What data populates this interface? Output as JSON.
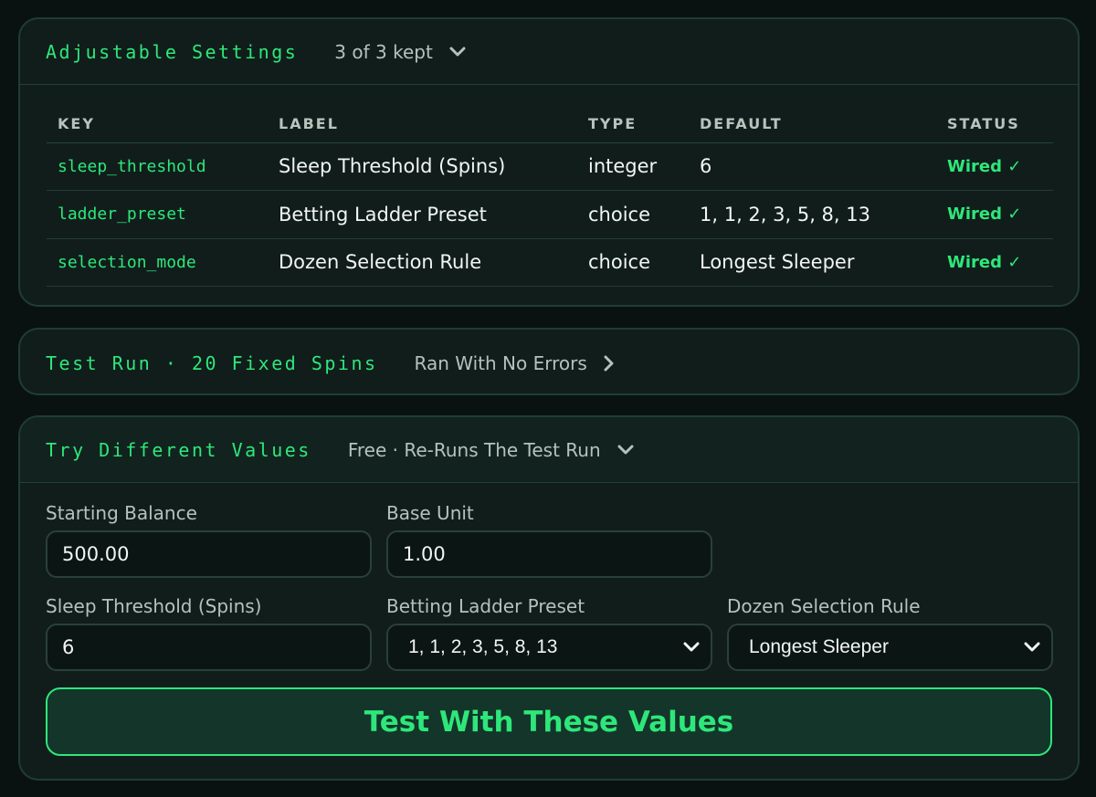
{
  "settings": {
    "title": "Adjustable Settings",
    "summary": "3 of 3 kept",
    "chevron": "chevron-down-icon",
    "columns": [
      "KEY",
      "LABEL",
      "TYPE",
      "DEFAULT",
      "STATUS"
    ],
    "rows": [
      {
        "key": "sleep_threshold",
        "label": "Sleep Threshold (Spins)",
        "type": "integer",
        "default": "6",
        "status": "Wired ✓"
      },
      {
        "key": "ladder_preset",
        "label": "Betting Ladder Preset",
        "type": "choice",
        "default": "1, 1, 2, 3, 5, 8, 13",
        "status": "Wired ✓"
      },
      {
        "key": "selection_mode",
        "label": "Dozen Selection Rule",
        "type": "choice",
        "default": "Longest Sleeper",
        "status": "Wired ✓"
      }
    ]
  },
  "test_run": {
    "title": "Test Run · 20 Fixed Spins",
    "result": "Ran With No Errors",
    "chevron": "chevron-right-icon"
  },
  "try_values": {
    "title": "Try Different Values",
    "subtitle": "Free · Re-Runs The Test Run",
    "chevron": "chevron-down-icon",
    "starting_balance": {
      "label": "Starting Balance",
      "value": "500.00"
    },
    "base_unit": {
      "label": "Base Unit",
      "value": "1.00"
    },
    "sleep_threshold": {
      "label": "Sleep Threshold (Spins)",
      "value": "6"
    },
    "ladder_preset": {
      "label": "Betting Ladder Preset",
      "value": "1, 1, 2, 3, 5, 8, 13"
    },
    "selection_rule": {
      "label": "Dozen Selection Rule",
      "value": "Longest Sleeper"
    },
    "submit_label": "Test With These Values"
  },
  "colors": {
    "accent": "#2ee77a",
    "background": "#0a1211",
    "panel": "#111d1b",
    "border": "#1f3d34"
  }
}
